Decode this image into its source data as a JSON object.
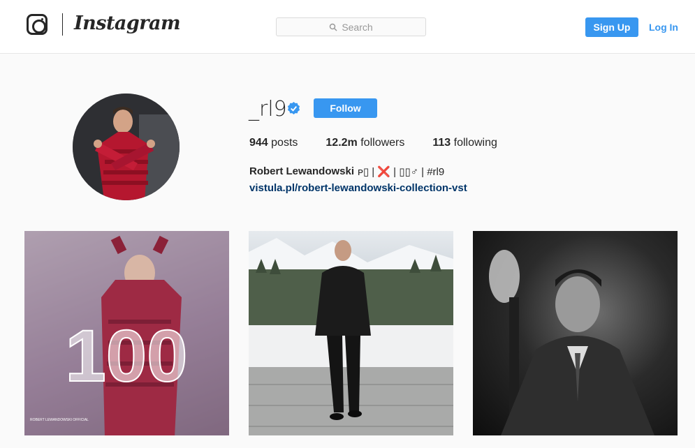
{
  "header": {
    "wordmark": "Instagram",
    "search_placeholder": "Search",
    "signup_label": "Sign Up",
    "login_label": "Log In",
    "icons": [
      "instagram-camera-icon",
      "search-icon"
    ]
  },
  "profile": {
    "username": "_rl9",
    "verified_icon": "verified-badge-icon",
    "follow_label": "Follow",
    "stats": [
      {
        "count": "944",
        "label": "posts"
      },
      {
        "count": "12.2m",
        "label": "followers"
      },
      {
        "count": "113",
        "label": "following"
      }
    ],
    "full_name": "Robert Lewandowski",
    "bio": "ᴘ▯ | ❌ | ▯▯♂ | #rl9",
    "link": "vistula.pl/robert-lewandowski-collection-vst"
  },
  "posts": [
    {
      "name": "post-1",
      "overlay_text": "100",
      "caption_text": "ROBERT LEWANDOWSKI OFFICIAL"
    },
    {
      "name": "post-2"
    },
    {
      "name": "post-3"
    }
  ],
  "colors": {
    "accent": "#3897f0",
    "link": "#003569",
    "text": "#262626",
    "background": "#fafafa"
  }
}
